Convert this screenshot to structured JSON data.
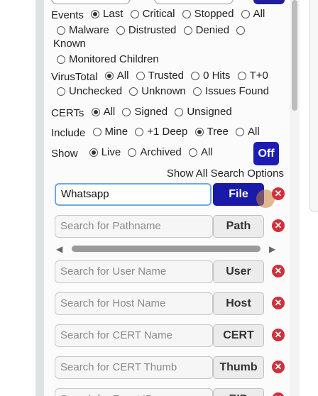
{
  "filters": {
    "events": {
      "label": "Events",
      "options": [
        {
          "label": "Last",
          "checked": true
        },
        {
          "label": "Critical",
          "checked": false
        },
        {
          "label": "Stopped",
          "checked": false
        },
        {
          "label": "All",
          "checked": false
        },
        {
          "label": "Malware",
          "checked": false
        },
        {
          "label": "Distrusted",
          "checked": false
        },
        {
          "label": "Denied",
          "checked": false
        },
        {
          "label": "Known",
          "checked": false
        },
        {
          "label": "Monitored Children",
          "checked": false
        }
      ]
    },
    "virustotal": {
      "label": "VirusTotal",
      "options": [
        {
          "label": "All",
          "checked": true
        },
        {
          "label": "Trusted",
          "checked": false
        },
        {
          "label": "0 Hits",
          "checked": false
        },
        {
          "label": "T+0",
          "checked": false
        },
        {
          "label": "Unchecked",
          "checked": false
        },
        {
          "label": "Unknown",
          "checked": false
        },
        {
          "label": "Issues Found",
          "checked": false
        }
      ]
    },
    "certs": {
      "label": "CERTs",
      "options": [
        {
          "label": "All",
          "checked": true
        },
        {
          "label": "Signed",
          "checked": false
        },
        {
          "label": "Unsigned",
          "checked": false
        }
      ]
    },
    "include": {
      "label": "Include",
      "options": [
        {
          "label": "Mine",
          "checked": false
        },
        {
          "label": "+1 Deep",
          "checked": false
        },
        {
          "label": "Tree",
          "checked": true
        },
        {
          "label": "All",
          "checked": false
        }
      ]
    },
    "show": {
      "label": "Show",
      "options": [
        {
          "label": "Live",
          "checked": true
        },
        {
          "label": "Archived",
          "checked": false
        },
        {
          "label": "All",
          "checked": false
        }
      ]
    }
  },
  "toggle": {
    "label": "Off"
  },
  "show_all_link": "Show All Search Options",
  "searches": [
    {
      "value": "Whatsapp",
      "placeholder": "",
      "button": "File"
    },
    {
      "value": "",
      "placeholder": "Search for Pathname",
      "button": "Path"
    },
    {
      "value": "",
      "placeholder": "Search for User Name",
      "button": "User"
    },
    {
      "value": "",
      "placeholder": "Search for Host Name",
      "button": "Host"
    },
    {
      "value": "",
      "placeholder": "Search for CERT Name",
      "button": "CERT"
    },
    {
      "value": "",
      "placeholder": "Search for CERT Thumb",
      "button": "Thumb"
    },
    {
      "value": "",
      "placeholder": "Search for Event ID",
      "button": "EID"
    }
  ],
  "colors": {
    "accent": "#1a1aa8",
    "clear": "#d32f3a"
  }
}
